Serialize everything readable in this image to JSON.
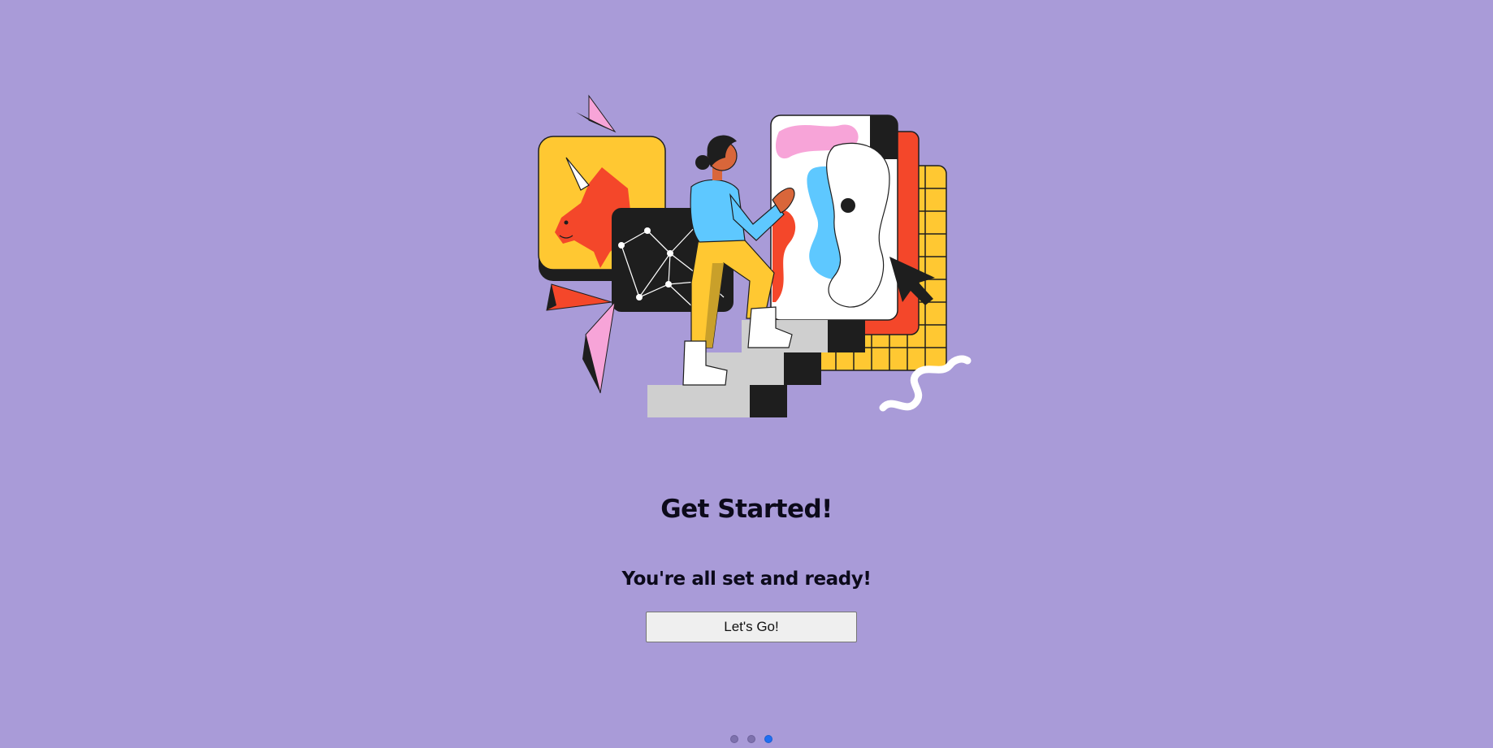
{
  "onboarding": {
    "title": "Get Started!",
    "subtitle": "You're all set and ready!",
    "cta_label": "Let's Go!",
    "illustration_icon": "person-climbing-stairs-illustration",
    "pagination": {
      "total": 3,
      "active_index": 2
    }
  },
  "colors": {
    "background": "#a99bd8",
    "active_dot": "#1f6ff2",
    "inactive_dot": "#7e72ad",
    "button_bg": "#efefef"
  }
}
